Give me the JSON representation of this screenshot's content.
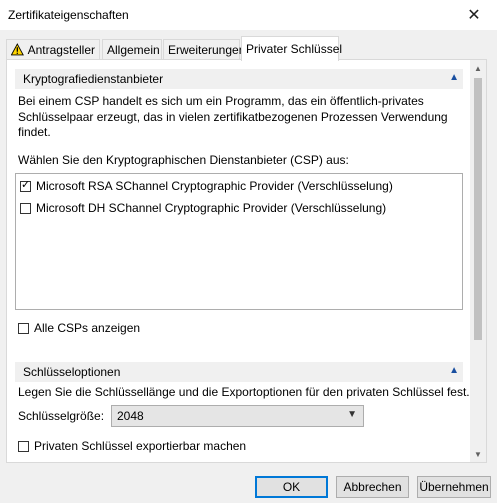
{
  "window": {
    "title": "Zertifikateigenschaften",
    "close_glyph": "✕"
  },
  "tabs": [
    {
      "label": "Antragsteller",
      "icon": "warning-icon"
    },
    {
      "label": "Allgemein"
    },
    {
      "label": "Erweiterungen"
    },
    {
      "label": "Privater Schlüssel",
      "active": true
    }
  ],
  "csp_section": {
    "title": "Kryptografiedienstanbieter",
    "description_lines": [
      "Bei einem CSP handelt es sich um ein Programm, das ein öffentlich-privates",
      "Schlüsselpaar erzeugt, das in vielen zertifikatbezogenen Prozessen Verwendung",
      "findet."
    ],
    "prompt": "Wählen Sie den Kryptographischen Dienstanbieter (CSP) aus:",
    "providers": [
      {
        "label": "Microsoft RSA SChannel Cryptographic Provider (Verschlüsselung)",
        "checked": true
      },
      {
        "label": "Microsoft DH SChannel Cryptographic Provider (Verschlüsselung)",
        "checked": false
      }
    ],
    "show_all_label": "Alle CSPs anzeigen"
  },
  "key_section": {
    "title": "Schlüsseloptionen",
    "description": "Legen Sie die Schlüssellänge und die Exportoptionen für den privaten Schlüssel fest.",
    "key_size_label": "Schlüsselgröße:",
    "key_size_value": "2048",
    "exportable_label": "Privaten Schlüssel exportierbar machen"
  },
  "buttons": {
    "ok": "OK",
    "cancel": "Abbrechen",
    "apply": "Übernehmen"
  },
  "colors": {
    "accent": "#0078d7",
    "chevron": "#1a4fa0"
  }
}
